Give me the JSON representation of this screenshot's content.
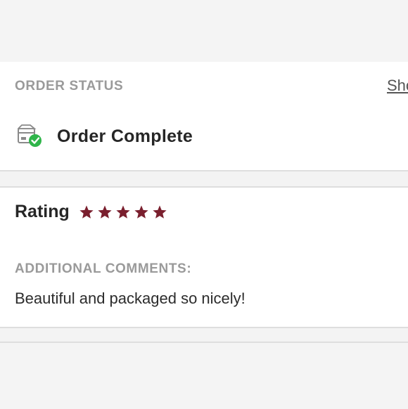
{
  "order_status": {
    "label": "ORDER STATUS",
    "link": "Sho",
    "status_text": "Order Complete",
    "icon": "box-check-icon",
    "status_color": "#2fb54a"
  },
  "rating": {
    "label": "Rating",
    "stars": 5,
    "max_stars": 5,
    "star_color": "#7a1f2e",
    "comments_label": "ADDITIONAL COMMENTS:",
    "comment": "Beautiful and packaged so nicely!"
  }
}
